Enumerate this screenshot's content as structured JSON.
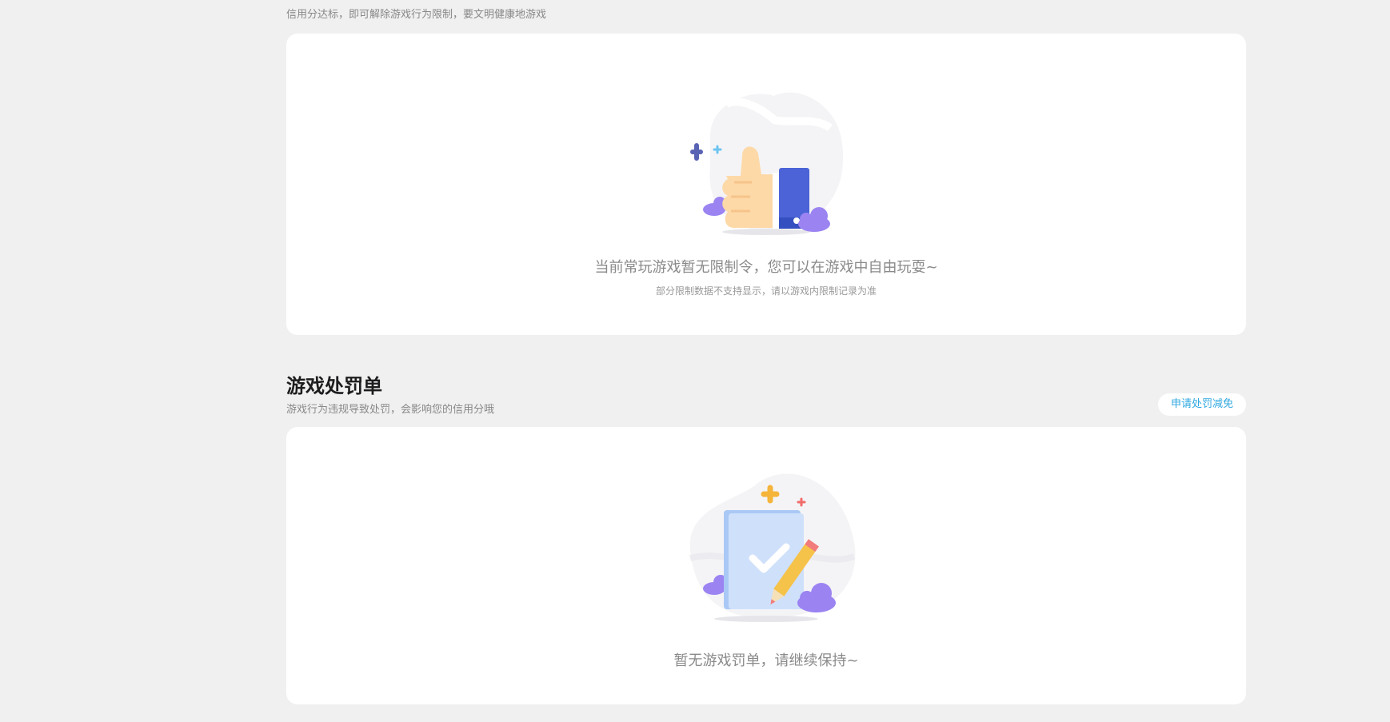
{
  "credit_section": {
    "subtitle": "信用分达标，即可解除游戏行为限制，要文明健康地游戏",
    "empty_message": "当前常玩游戏暂无限制令，您可以在游戏中自由玩耍~",
    "empty_note": "部分限制数据不支持显示，请以游戏内限制记录为准",
    "illustration_icon": "thumbs-up-icon"
  },
  "penalty_section": {
    "title": "游戏处罚单",
    "subtitle": "游戏行为违规导致处罚，会影响您的信用分哦",
    "apply_button_label": "申请处罚减免",
    "empty_message": "暂无游戏罚单，请继续保持~",
    "illustration_icon": "checklist-pencil-icon"
  },
  "colors": {
    "page_background": "#f0f0f0",
    "card_background": "#ffffff",
    "accent_link": "#2fa8e0",
    "title_text": "#1d1d1f",
    "muted_text": "#888888"
  }
}
